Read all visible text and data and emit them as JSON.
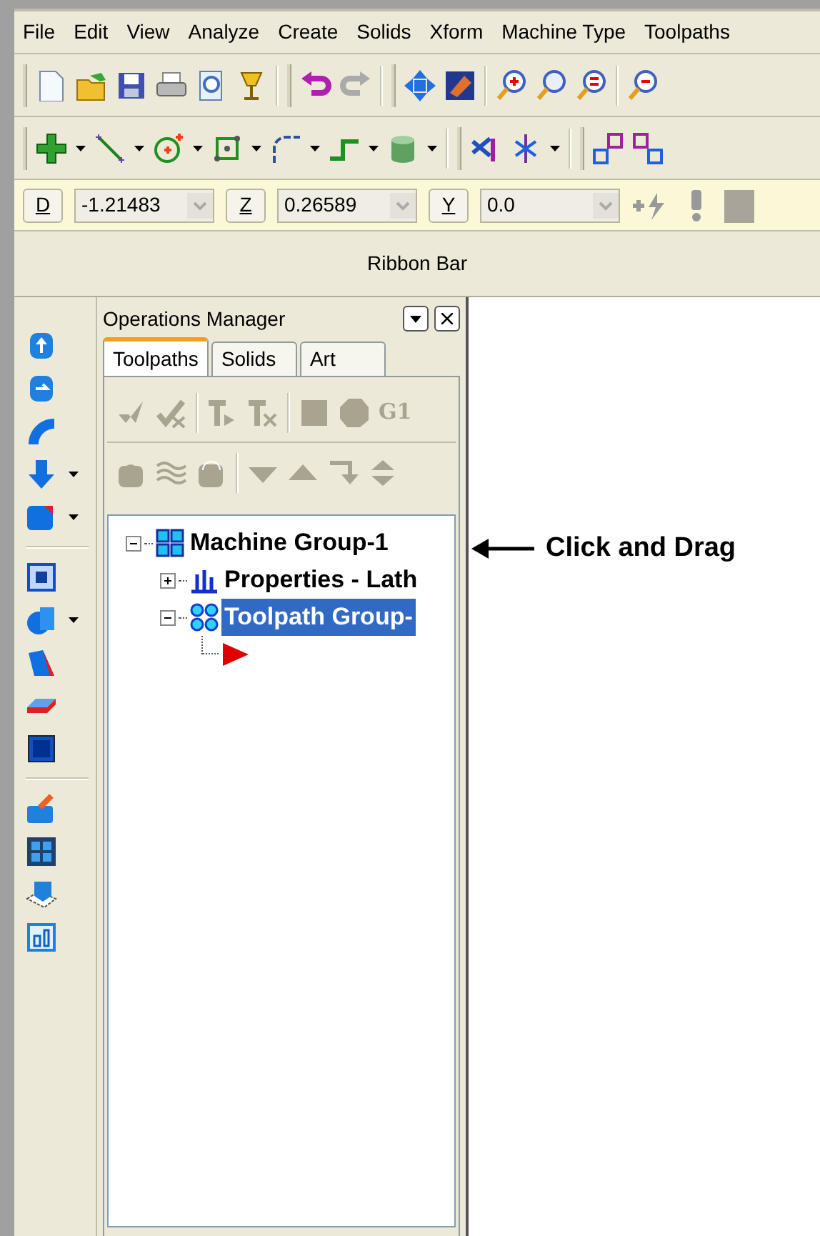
{
  "menu": [
    "File",
    "Edit",
    "View",
    "Analyze",
    "Create",
    "Solids",
    "Xform",
    "Machine Type",
    "Toolpaths"
  ],
  "ribbon_fields": [
    {
      "button": "D",
      "value": "-1.21483"
    },
    {
      "button": "Z",
      "value": "0.26589"
    },
    {
      "button": "Y",
      "value": "0.0"
    }
  ],
  "ribbon_bar": {
    "label": "Ribbon Bar"
  },
  "operations_manager": {
    "title": "Operations Manager",
    "tabs": [
      {
        "label": "Toolpaths",
        "selected": true
      },
      {
        "label": "Solids",
        "selected": false
      },
      {
        "label": "Art",
        "selected": false
      }
    ],
    "toolbar_text": "G1",
    "tree": [
      {
        "kind": "machine-group",
        "label": "Machine Group-1",
        "expanded": true,
        "selected": false,
        "children": [
          {
            "kind": "properties",
            "label": "Properties - Lath",
            "expanded": false,
            "selected": false
          },
          {
            "kind": "toolpath-group",
            "label": "Toolpath Group-",
            "expanded": true,
            "selected": true,
            "children": [
              {
                "kind": "end-marker"
              }
            ]
          }
        ]
      }
    ]
  },
  "callout": {
    "label": "Click and Drag"
  }
}
